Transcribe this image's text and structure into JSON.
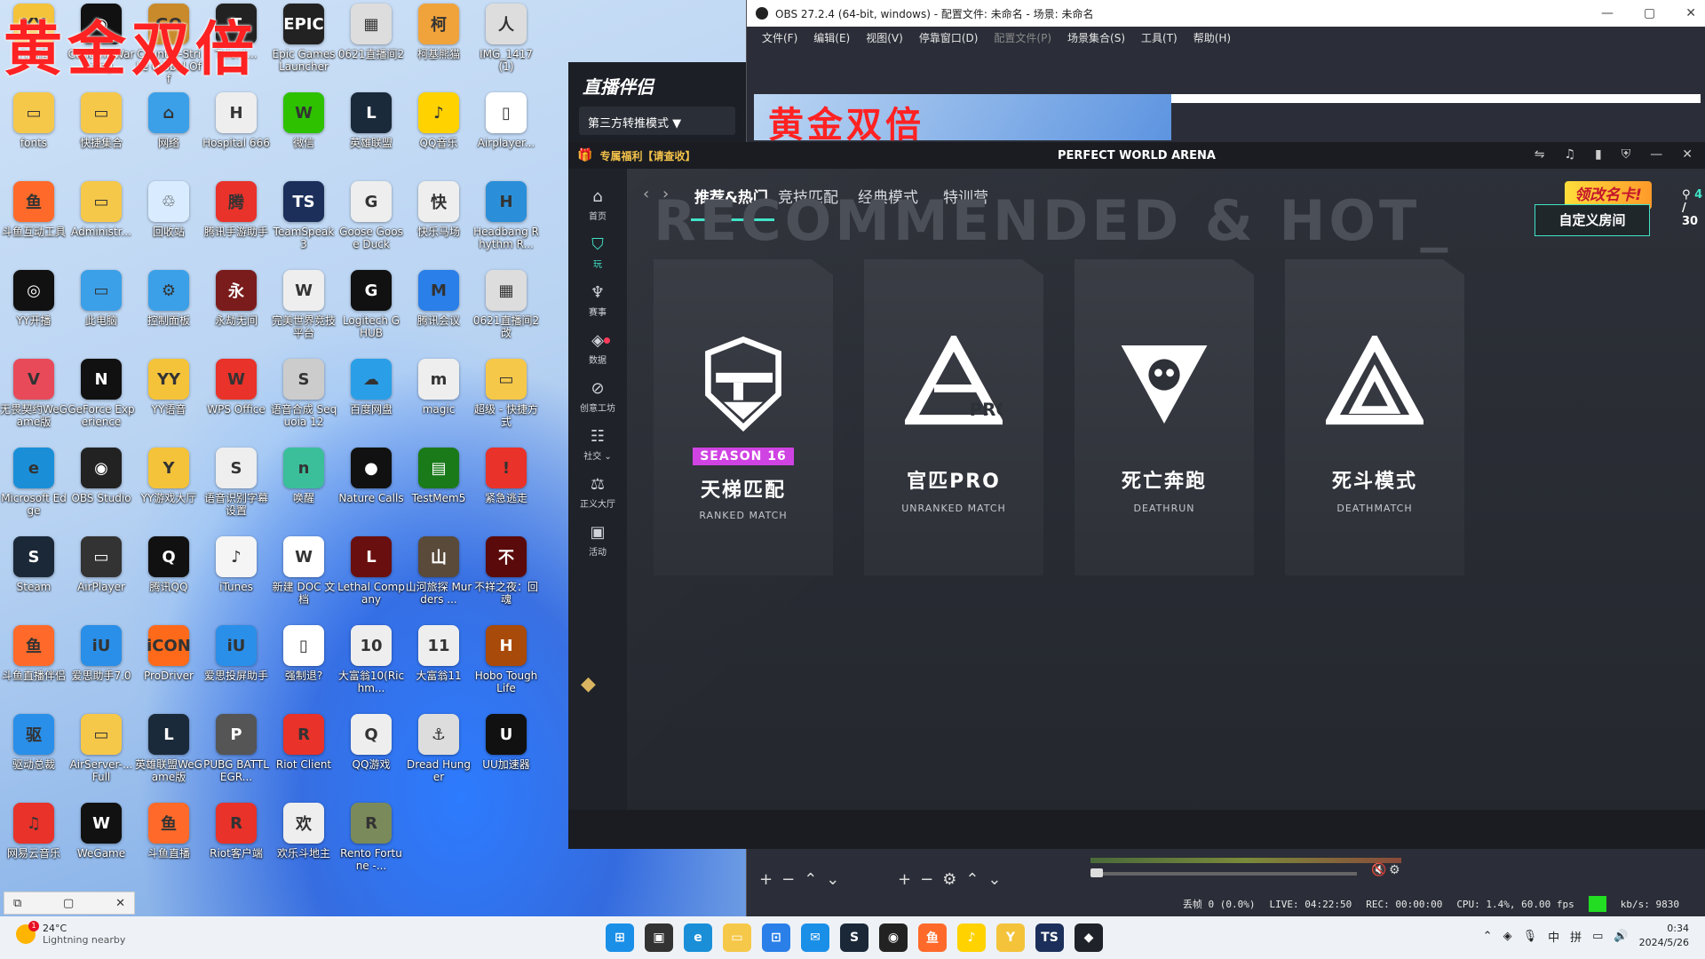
{
  "overlay_title": "黄金双倍",
  "desktop_icons": [
    {
      "label": "YY语音",
      "c": "#f4c33a",
      "g": "YY"
    },
    {
      "label": "Content Warning",
      "c": "#111",
      "g": "◉"
    },
    {
      "label": "Counter-Strike Global Off",
      "c": "#c88a2a",
      "g": "GO"
    },
    {
      "label": "Talent...",
      "c": "#222",
      "g": "T"
    },
    {
      "label": "Epic Games Launcher",
      "c": "#222",
      "g": "EPIC"
    },
    {
      "label": "0621直播间2",
      "c": "#ddd",
      "g": "▦"
    },
    {
      "label": "柯基熊猫",
      "c": "#f1a33b",
      "g": "柯"
    },
    {
      "label": "IMG_1417 (1)",
      "c": "#ddd",
      "g": "人"
    },
    {
      "label": "fonts",
      "c": "#f6c84a",
      "g": "▭"
    },
    {
      "label": "快捷集合",
      "c": "#f6c84a",
      "g": "▭"
    },
    {
      "label": "网络",
      "c": "#3ba0e8",
      "g": "⌂"
    },
    {
      "label": "Hospital 666",
      "c": "#eee",
      "g": "H"
    },
    {
      "label": "微信",
      "c": "#2dc100",
      "g": "W"
    },
    {
      "label": "英雄联盟",
      "c": "#1b2a3a",
      "g": "L"
    },
    {
      "label": "QQ音乐",
      "c": "#ffd200",
      "g": "♪"
    },
    {
      "label": "Airplayer...",
      "c": "#fff",
      "g": "▯"
    },
    {
      "label": "斗鱼互动工具",
      "c": "#ff6a2a",
      "g": "鱼"
    },
    {
      "label": "Administr...",
      "c": "#f6c84a",
      "g": "▭"
    },
    {
      "label": "回收站",
      "c": "#d9ecff",
      "g": "♲"
    },
    {
      "label": "腾讯手游助手",
      "c": "#e8322a",
      "g": "腾"
    },
    {
      "label": "TeamSpeak 3",
      "c": "#1c2f5a",
      "g": "TS"
    },
    {
      "label": "Goose Goose Duck",
      "c": "#eee",
      "g": "G"
    },
    {
      "label": "快乐马场",
      "c": "#eee",
      "g": "快"
    },
    {
      "label": "Headbang Rhythm R...",
      "c": "#2a8fd8",
      "g": "H"
    },
    {
      "label": "YY开播",
      "c": "#111",
      "g": "◎"
    },
    {
      "label": "此电脑",
      "c": "#3ba0e8",
      "g": "▭"
    },
    {
      "label": "控制面板",
      "c": "#3ba0e8",
      "g": "⚙"
    },
    {
      "label": "永劫无间",
      "c": "#7a1c1c",
      "g": "永"
    },
    {
      "label": "完美世界竞技平台",
      "c": "#eee",
      "g": "W"
    },
    {
      "label": "Logitech G HUB",
      "c": "#111",
      "g": "G"
    },
    {
      "label": "腾讯会议",
      "c": "#2a7fe8",
      "g": "M"
    },
    {
      "label": "0621直播间2改",
      "c": "#ddd",
      "g": "▦"
    },
    {
      "label": "无畏契约WeGame版",
      "c": "#e84a5a",
      "g": "V"
    },
    {
      "label": "GeForce Experience",
      "c": "#111",
      "g": "N"
    },
    {
      "label": "YY语音",
      "c": "#f4c33a",
      "g": "YY"
    },
    {
      "label": "WPS Office",
      "c": "#e8322a",
      "g": "W"
    },
    {
      "label": "语音合成 Sequoia 12",
      "c": "#ccc",
      "g": "S"
    },
    {
      "label": "百度网盘",
      "c": "#2a9fe8",
      "g": "☁"
    },
    {
      "label": "magic",
      "c": "#eee",
      "g": "m"
    },
    {
      "label": "超级 - 快捷方式",
      "c": "#f6c84a",
      "g": "▭"
    },
    {
      "label": "Microsoft Edge",
      "c": "#1a8fd8",
      "g": "e"
    },
    {
      "label": "OBS Studio",
      "c": "#222",
      "g": "◉"
    },
    {
      "label": "YY游戏大厅",
      "c": "#f4c33a",
      "g": "Y"
    },
    {
      "label": "语音识别字幕设置",
      "c": "#eee",
      "g": "S"
    },
    {
      "label": "唤醒",
      "c": "#3bbf9a",
      "g": "n"
    },
    {
      "label": "Nature Calls",
      "c": "#111",
      "g": "●"
    },
    {
      "label": "TestMem5",
      "c": "#1a7a1a",
      "g": "▤"
    },
    {
      "label": "紧急逃走",
      "c": "#e8322a",
      "g": "!"
    },
    {
      "label": "Steam",
      "c": "#1b2838",
      "g": "S"
    },
    {
      "label": "AirPlayer",
      "c": "#333",
      "g": "▭"
    },
    {
      "label": "腾讯QQ",
      "c": "#111",
      "g": "Q"
    },
    {
      "label": "iTunes",
      "c": "#f5f5f5",
      "g": "♪"
    },
    {
      "label": "新建 DOC 文档",
      "c": "#fff",
      "g": "W"
    },
    {
      "label": "Lethal Company",
      "c": "#6a0f0f",
      "g": "L"
    },
    {
      "label": "山河旅探 Murders ...",
      "c": "#5a4a3a",
      "g": "山"
    },
    {
      "label": "不祥之夜：回魂",
      "c": "#5a0a0a",
      "g": "不"
    },
    {
      "label": "斗鱼直播伴侣",
      "c": "#ff6a2a",
      "g": "鱼"
    },
    {
      "label": "爱思助手7.0",
      "c": "#2a8fe8",
      "g": "iU"
    },
    {
      "label": "ProDriver",
      "c": "#ff6a1a",
      "g": "iCON"
    },
    {
      "label": "爱思投屏助手",
      "c": "#2a8fe8",
      "g": "iU"
    },
    {
      "label": "强制退?",
      "c": "#fff",
      "g": "▯"
    },
    {
      "label": "大富翁10(Richm...",
      "c": "#eee",
      "g": "10"
    },
    {
      "label": "大富翁11",
      "c": "#eee",
      "g": "11"
    },
    {
      "label": "Hobo Tough Life",
      "c": "#a84a0a",
      "g": "H"
    },
    {
      "label": "驱动总裁",
      "c": "#2a8fe8",
      "g": "驱"
    },
    {
      "label": "AirServer-... Full",
      "c": "#f6c84a",
      "g": "▭"
    },
    {
      "label": "英雄联盟WeGame版",
      "c": "#1b2a3a",
      "g": "L"
    },
    {
      "label": "PUBG BATTLEGR...",
      "c": "#555",
      "g": "P"
    },
    {
      "label": "Riot Client",
      "c": "#e8322a",
      "g": "R"
    },
    {
      "label": "QQ游戏",
      "c": "#eee",
      "g": "Q"
    },
    {
      "label": "Dread Hunger",
      "c": "#ddd",
      "g": "⚓"
    },
    {
      "label": "UU加速器",
      "c": "#111",
      "g": "U"
    },
    {
      "label": "网易云音乐",
      "c": "#e8322a",
      "g": "♫"
    },
    {
      "label": "WeGame",
      "c": "#111",
      "g": "W"
    },
    {
      "label": "斗鱼直播",
      "c": "#ff6a2a",
      "g": "鱼"
    },
    {
      "label": "Riot客户端",
      "c": "#e8322a",
      "g": "R"
    },
    {
      "label": "欢乐斗地主",
      "c": "#eee",
      "g": "欢"
    },
    {
      "label": "Rento Fortune -...",
      "c": "#7a8a5a",
      "g": "R"
    }
  ],
  "obs": {
    "title": "OBS 27.2.4 (64-bit, windows) - 配置文件: 未命名 - 场景: 未命名",
    "menu": [
      "文件(F)",
      "编辑(E)",
      "视图(V)",
      "停靠窗口(D)",
      "配置文件(P)",
      "场景集合(S)",
      "工具(T)",
      "帮助(H)"
    ],
    "status": {
      "dropped": "丢帧 0 (0.0%)",
      "live": "LIVE: 04:22:50",
      "rec": "REC: 00:00:00",
      "cpu": "CPU: 1.4%, 60.00 fps",
      "kbps": "kb/s: 9830"
    }
  },
  "companion": {
    "brand": "直播伴侣",
    "mode": "第三方转推模式"
  },
  "pwa": {
    "gift_text": "专属福利【请查收】",
    "title": "PERFECT WORLD ARENA",
    "tabs": [
      "推荐&热门",
      "竞技匹配",
      "经典模式",
      "特训营"
    ],
    "promo": "领改名卡!",
    "counter_current": "4",
    "counter_total": "/ 30",
    "heading": "RECOMMENDED & HOT_",
    "custom_room": "自定义房间",
    "sidebar": [
      {
        "label": "首页",
        "icon": "⌂"
      },
      {
        "label": "玩",
        "icon": "⛉"
      },
      {
        "label": "赛事",
        "icon": "♆"
      },
      {
        "label": "数据",
        "icon": "◈"
      },
      {
        "label": "创意工坊",
        "icon": "⊘"
      },
      {
        "label": "社交 ⌄",
        "icon": "☷"
      },
      {
        "label": "正义大厅",
        "icon": "⚖"
      },
      {
        "label": "活动",
        "icon": "▣"
      }
    ],
    "cards": [
      {
        "season": "SEASON 16",
        "cn": "天梯匹配",
        "en": "RANKED MATCH"
      },
      {
        "season": "",
        "cn": "官匹PRO",
        "en": "UNRANKED MATCH"
      },
      {
        "season": "",
        "cn": "死亡奔跑",
        "en": "DEATHRUN"
      },
      {
        "season": "",
        "cn": "死斗模式",
        "en": "DEATHMATCH"
      }
    ]
  },
  "taskbar": {
    "temp": "24°C",
    "weather": "Lightning nearby",
    "weather_badge": "1",
    "time": "0:34",
    "date": "2024/5/26",
    "ime1": "中",
    "ime2": "拼"
  }
}
